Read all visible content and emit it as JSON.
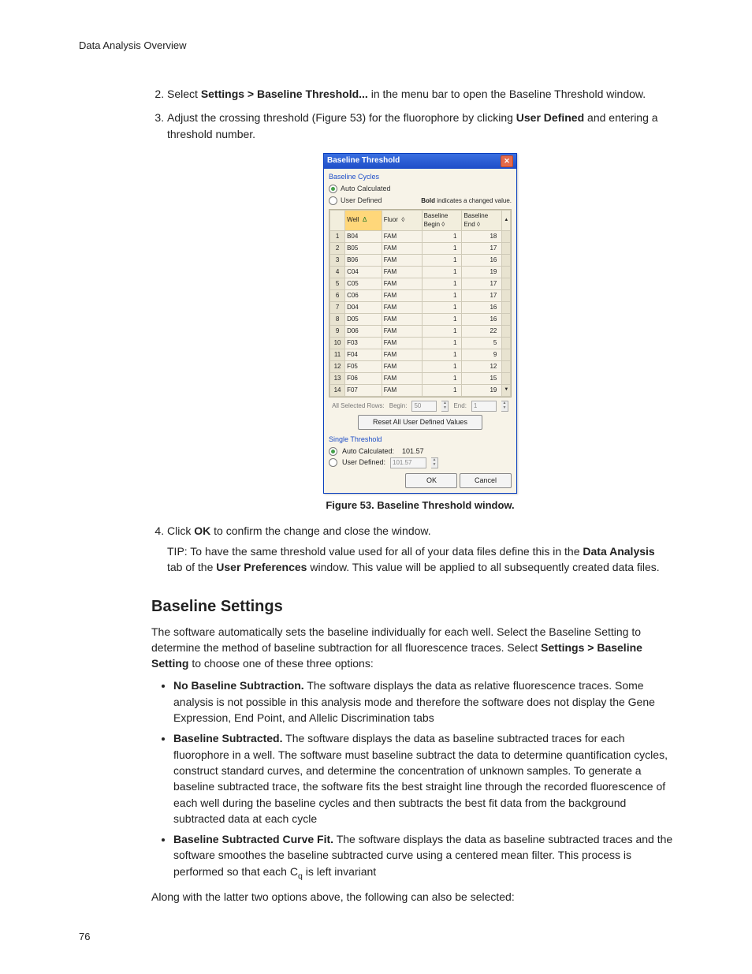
{
  "header": "Data Analysis Overview",
  "page_number": "76",
  "steps": {
    "s2a": "Select ",
    "s2b": "Settings > Baseline Threshold...",
    "s2c": " in the menu bar to open the Baseline Threshold window.",
    "s3a": "Adjust the crossing threshold (Figure 53) for the fluorophore by clicking ",
    "s3b": "User Defined",
    "s3c": " and entering a threshold number.",
    "s4a": "Click ",
    "s4b": "OK",
    "s4c": " to confirm the change and close the window.",
    "tip1": "TIP: To have the same threshold value used for all of your data files define this in the ",
    "tip2": "Data Analysis",
    "tip3": " tab of the ",
    "tip4": "User Preferences",
    "tip5": " window. This value will be applied to all subsequently created data files."
  },
  "figure_caption": "Figure 53. Baseline Threshold window.",
  "section_heading": "Baseline Settings",
  "intro1": "The software automatically sets the baseline individually for each well. Select the Baseline Setting to determine the method of baseline subtraction for all fluorescence traces. Select ",
  "intro2": "Settings > Baseline Setting",
  "intro3": " to choose one of these three options:",
  "bullets": {
    "b1t": "No Baseline Subtraction.",
    "b1": " The software displays the data as relative fluorescence traces. Some analysis is not possible in this analysis mode and therefore the software does not display the Gene Expression, End Point, and Allelic Discrimination tabs",
    "b2t": "Baseline Subtracted.",
    "b2": " The software displays the data as baseline subtracted traces for each fluorophore in a well. The software must baseline subtract the data to determine quantification cycles, construct standard curves, and determine the concentration of unknown samples. To generate a baseline subtracted trace, the software fits the best straight line through the recorded fluorescence of each well during the baseline cycles and then subtracts the best fit data from the background subtracted data at each cycle",
    "b3t": "Baseline Subtracted Curve Fit.",
    "b3a": " The software displays the data as baseline subtracted traces and the software smoothes the baseline subtracted curve using a centered mean filter. This process is performed so that each C",
    "b3q": "q",
    "b3b": " is left invariant"
  },
  "closing": "Along with the latter two options above, the following can also be selected:",
  "dlg": {
    "title": "Baseline Threshold",
    "section_cycles": "Baseline Cycles",
    "radio_auto": "Auto Calculated",
    "radio_user": "User Defined",
    "bold_note_b": "Bold",
    "bold_note": " indicates a changed value.",
    "cols": {
      "well": "Well",
      "fluor": "Fluor",
      "begin": "Baseline Begin",
      "end": "Baseline End"
    },
    "diamond": "◊",
    "delta": "Δ",
    "rows": [
      {
        "n": "1",
        "well": "B04",
        "fluor": "FAM",
        "begin": "1",
        "end": "18"
      },
      {
        "n": "2",
        "well": "B05",
        "fluor": "FAM",
        "begin": "1",
        "end": "17"
      },
      {
        "n": "3",
        "well": "B06",
        "fluor": "FAM",
        "begin": "1",
        "end": "16"
      },
      {
        "n": "4",
        "well": "C04",
        "fluor": "FAM",
        "begin": "1",
        "end": "19"
      },
      {
        "n": "5",
        "well": "C05",
        "fluor": "FAM",
        "begin": "1",
        "end": "17"
      },
      {
        "n": "6",
        "well": "C06",
        "fluor": "FAM",
        "begin": "1",
        "end": "17"
      },
      {
        "n": "7",
        "well": "D04",
        "fluor": "FAM",
        "begin": "1",
        "end": "16"
      },
      {
        "n": "8",
        "well": "D05",
        "fluor": "FAM",
        "begin": "1",
        "end": "16"
      },
      {
        "n": "9",
        "well": "D06",
        "fluor": "FAM",
        "begin": "1",
        "end": "22"
      },
      {
        "n": "10",
        "well": "F03",
        "fluor": "FAM",
        "begin": "1",
        "end": "5"
      },
      {
        "n": "11",
        "well": "F04",
        "fluor": "FAM",
        "begin": "1",
        "end": "9"
      },
      {
        "n": "12",
        "well": "F05",
        "fluor": "FAM",
        "begin": "1",
        "end": "12"
      },
      {
        "n": "13",
        "well": "F06",
        "fluor": "FAM",
        "begin": "1",
        "end": "15"
      },
      {
        "n": "14",
        "well": "F07",
        "fluor": "FAM",
        "begin": "1",
        "end": "19"
      }
    ],
    "all_rows": "All Selected Rows:",
    "begin_lbl": "Begin:",
    "begin_val": "50",
    "end_lbl": "End:",
    "end_val": "1",
    "reset_btn": "Reset All User Defined Values",
    "section_thresh": "Single Threshold",
    "auto_calc_lbl": "Auto Calculated:",
    "auto_calc_val": "101.57",
    "user_def_lbl": "User Defined:",
    "user_def_val": "101.57",
    "ok": "OK",
    "cancel": "Cancel"
  }
}
